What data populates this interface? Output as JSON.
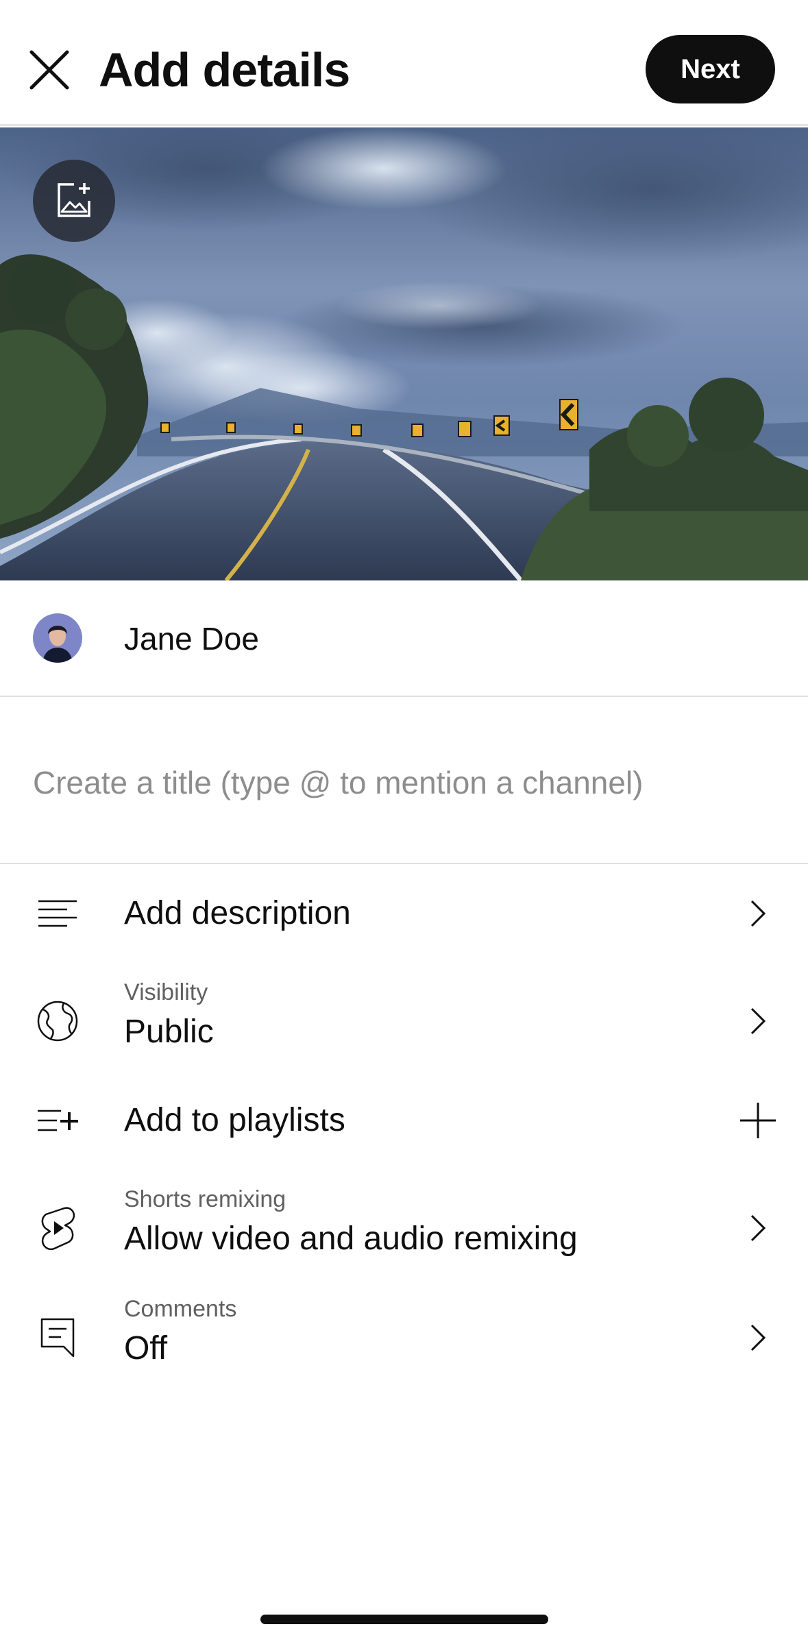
{
  "header": {
    "title": "Add details",
    "next_label": "Next"
  },
  "thumbnail": {
    "edit_icon": "add-photo-icon"
  },
  "channel": {
    "name": "Jane Doe"
  },
  "title_field": {
    "value": "",
    "placeholder": "Create a title (type @ to mention a channel)"
  },
  "settings": {
    "description": {
      "value": "Add description",
      "icon": "description-icon",
      "trailing": "chevron-right-icon"
    },
    "visibility": {
      "label": "Visibility",
      "value": "Public",
      "icon": "globe-icon",
      "trailing": "chevron-right-icon"
    },
    "playlists": {
      "value": "Add to playlists",
      "icon": "playlist-add-icon",
      "trailing": "plus-icon"
    },
    "remixing": {
      "label": "Shorts remixing",
      "value": "Allow video and audio remixing",
      "icon": "shorts-icon",
      "trailing": "chevron-right-icon"
    },
    "comments": {
      "label": "Comments",
      "value": "Off",
      "icon": "comment-icon",
      "trailing": "chevron-right-icon"
    }
  },
  "colors": {
    "text_primary": "#0f0f0f",
    "text_secondary": "#606060",
    "placeholder": "#8d8d8d",
    "divider": "#e0e0e0",
    "button_bg": "#0f0f0f",
    "button_text": "#ffffff"
  }
}
